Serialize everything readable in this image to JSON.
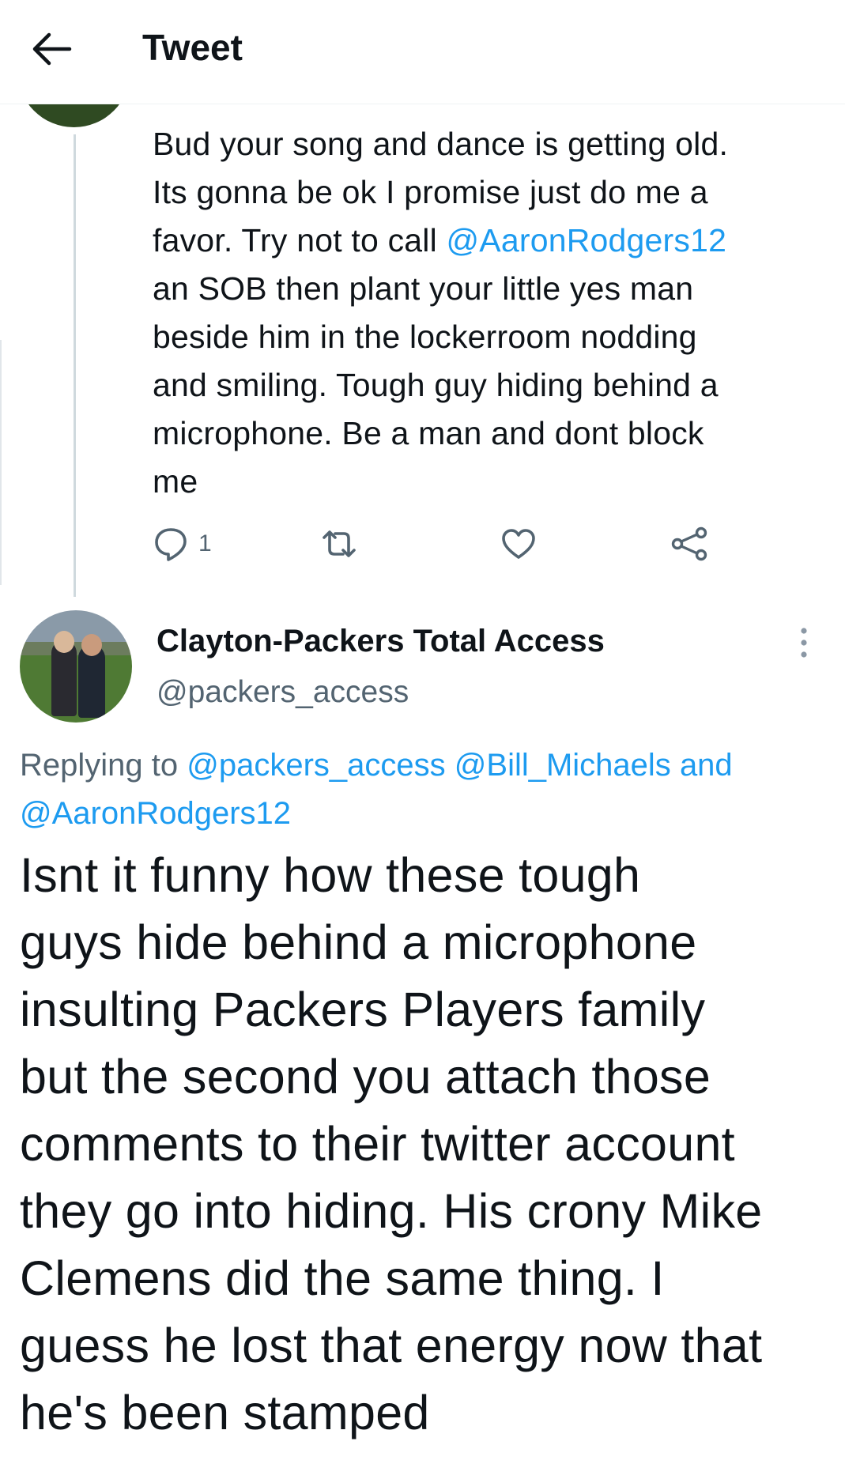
{
  "header": {
    "title": "Tweet"
  },
  "tweet1": {
    "body_before_mention": "Bud your song and dance is getting old.\nIts gonna be ok I promise just do me a\nfavor. Try not to call ",
    "mention": "@AaronRodgers12",
    "body_after_mention": "\nan SOB then plant your little yes man\nbeside him in the lockerroom nodding\nand smiling. Tough guy hiding behind a\nmicrophone. Be a man and dont block\nme",
    "reply_count": "1",
    "accent_color": "#1d9bf0"
  },
  "tweet2": {
    "display_name": "Clayton-Packers Total Access",
    "handle": "@packers_access",
    "replying_to_prefix": "Replying to",
    "replying_mention_1": "@packers_access",
    "replying_mention_2": "@Bill_Michaels",
    "replying_and": "and",
    "replying_mention_3": "@AaronRodgers12",
    "body": "Isnt it funny how these tough\nguys hide behind a microphone\ninsulting Packers Players family\nbut the second you attach those\ncomments to their twitter account\nthey go into hiding. His crony Mike\nClemens did the same thing. I\nguess he lost that energy now that\nhe's been stamped"
  },
  "icons": [
    "back-arrow-icon",
    "reply-icon",
    "retweet-icon",
    "like-icon",
    "share-icon",
    "more-icon"
  ]
}
